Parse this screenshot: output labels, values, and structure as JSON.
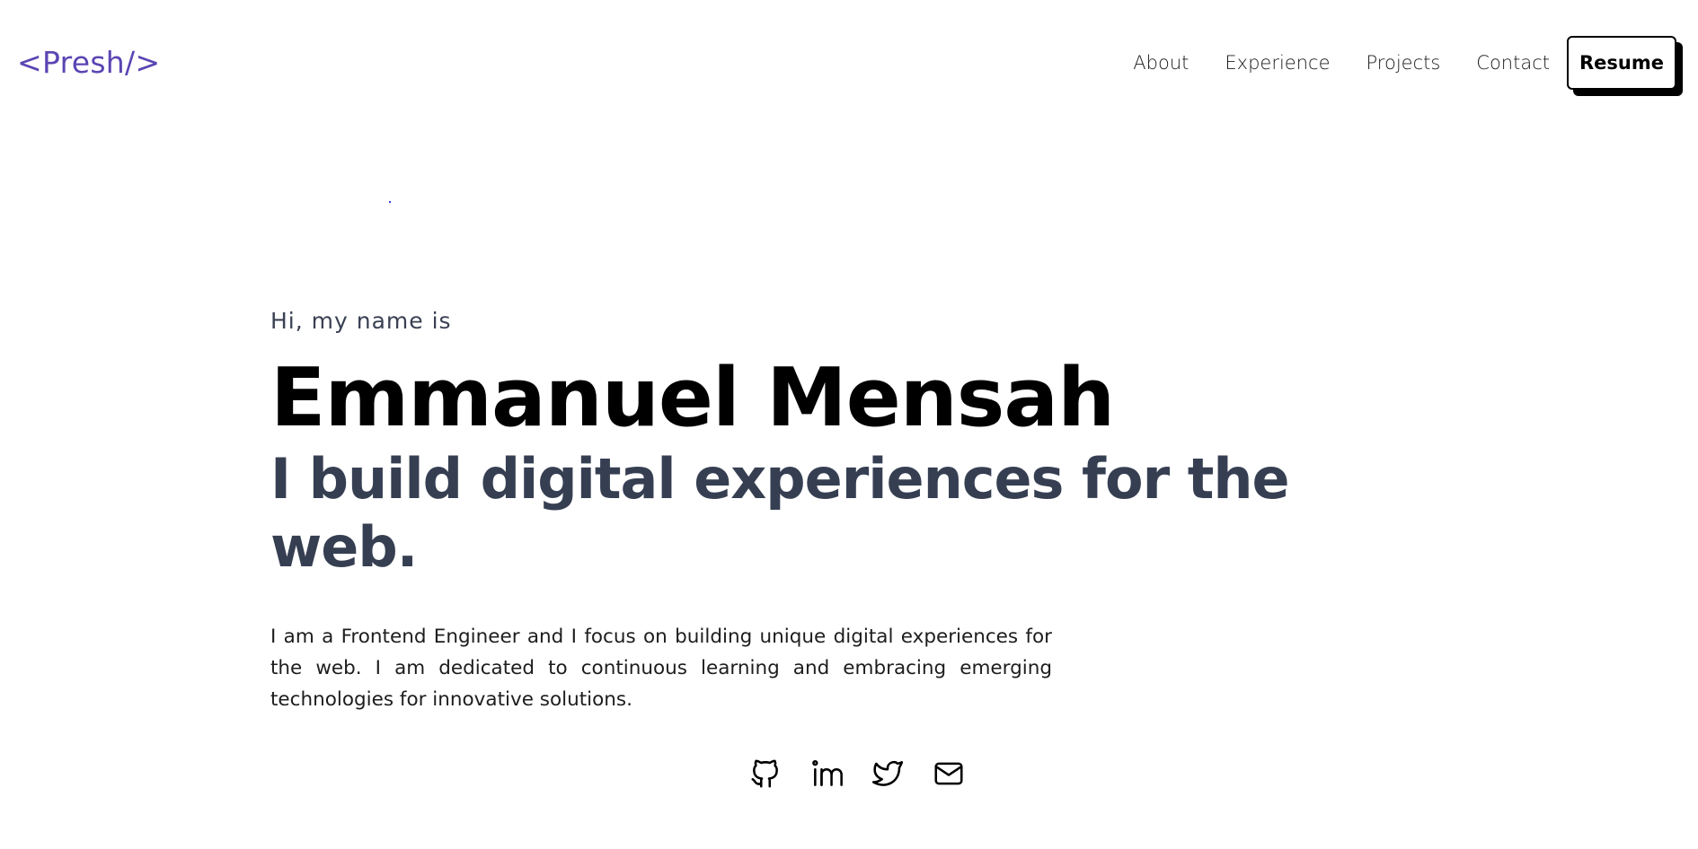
{
  "header": {
    "logo": "<Presh/>",
    "nav_links": [
      "About",
      "Experience",
      "Projects",
      "Contact"
    ],
    "resume_label": "Resume"
  },
  "hero": {
    "greeting": "Hi, my name is",
    "name": "Emmanuel Mensah",
    "tagline": "I build digital experiences for the web.",
    "bio": "I am a Frontend Engineer and I focus on building unique digital experiences for the web. I am dedicated to continuous learning and embracing emerging technologies for innovative solutions."
  },
  "social": {
    "icons": [
      "github-icon",
      "linkedin-icon",
      "twitter-icon",
      "mail-icon"
    ]
  },
  "colors": {
    "brand": "#5b45b3",
    "tagline": "#363f52",
    "greeting": "#3a4153"
  }
}
